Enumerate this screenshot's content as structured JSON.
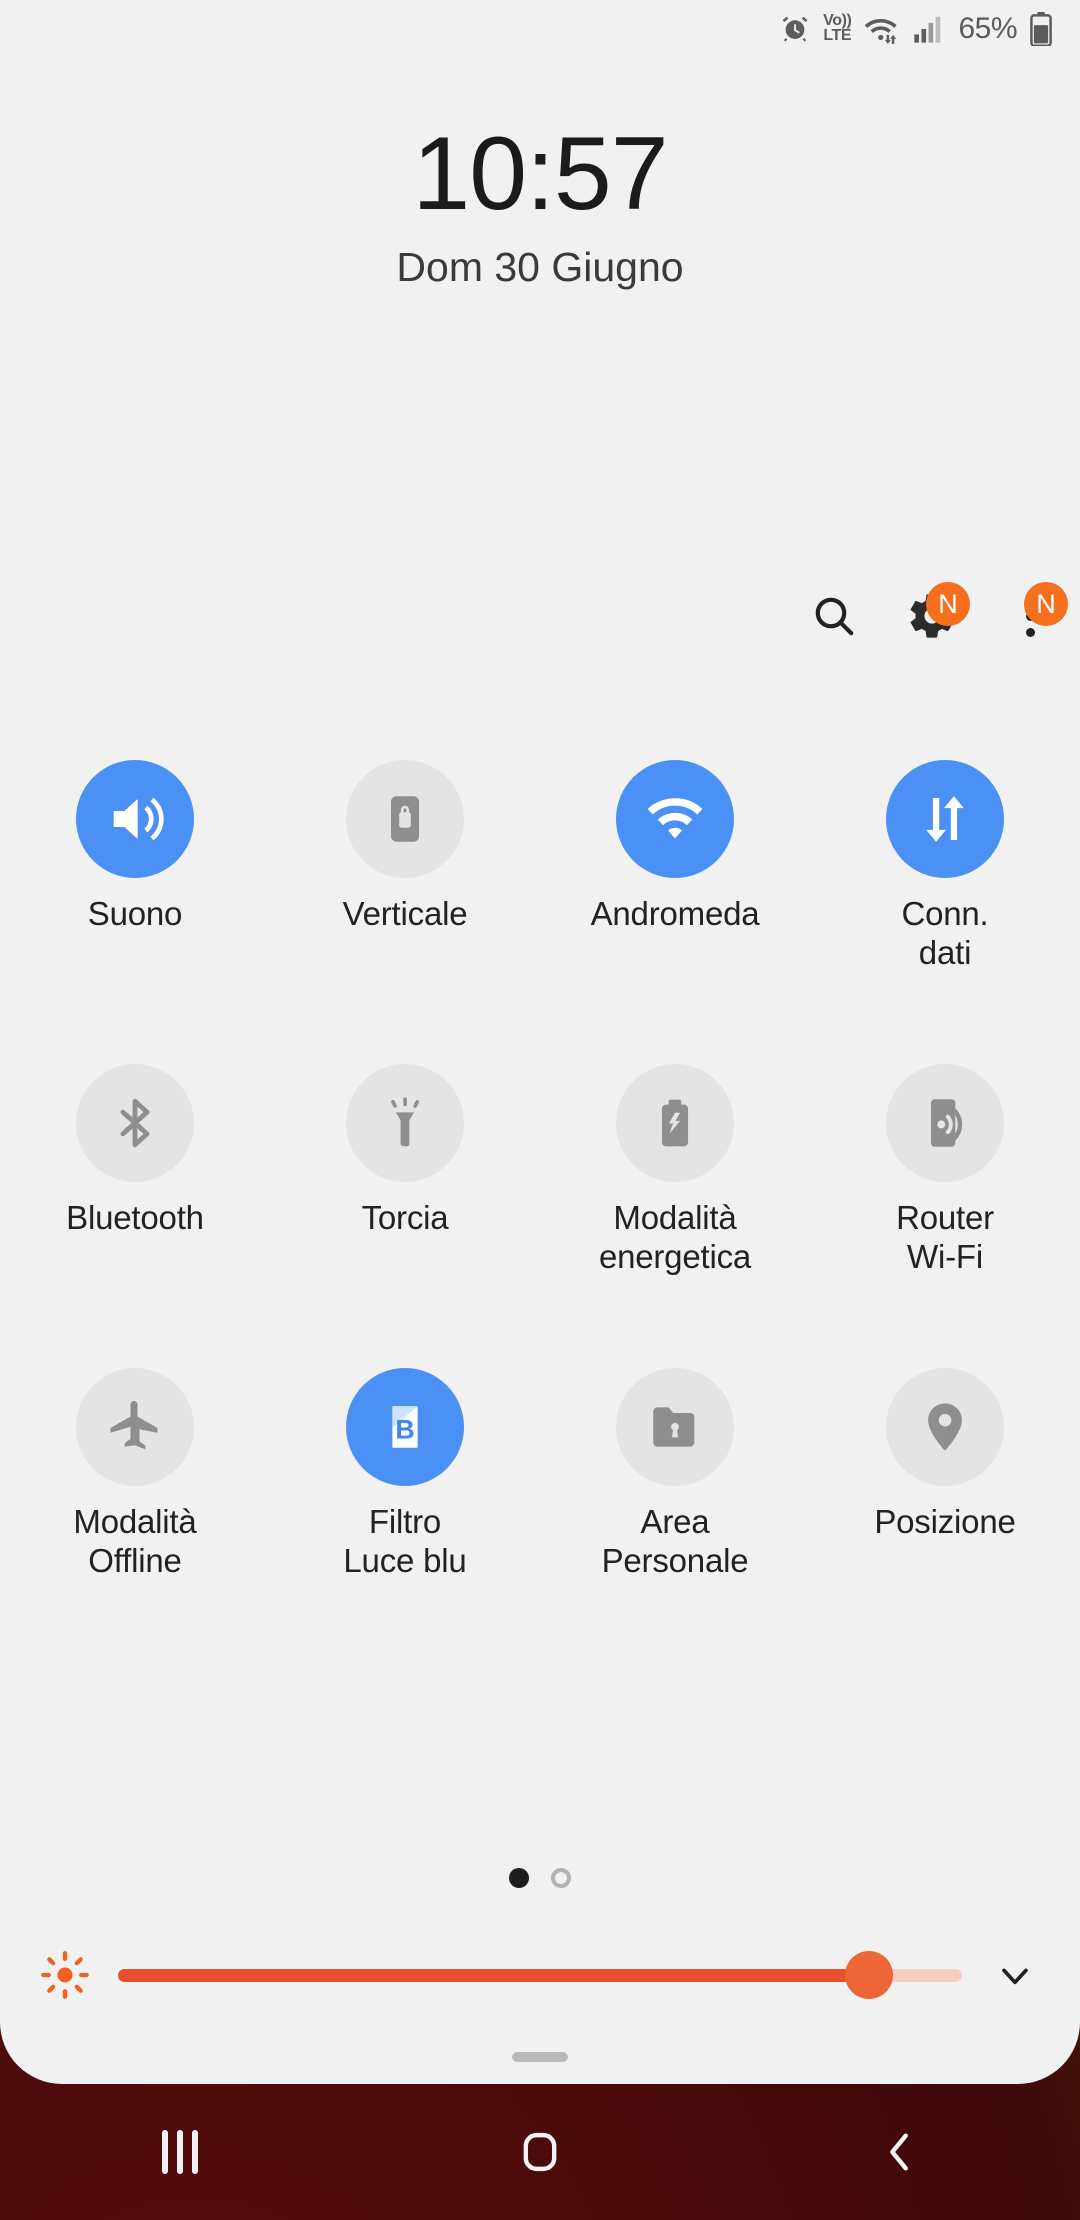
{
  "statusbar": {
    "alarm_icon": "alarm-clock-icon",
    "volte_top": "Vo))",
    "volte_bottom": "LTE",
    "wifi_icon": "wifi-data-transfer-icon",
    "signal_icon": "cellular-signal-icon",
    "battery_percent": "65%",
    "battery_icon": "battery-icon"
  },
  "clock": {
    "time": "10:57",
    "date": "Dom 30 Giugno"
  },
  "actions": {
    "search": {
      "name": "search-icon",
      "label": "Cerca"
    },
    "settings": {
      "name": "gear-icon",
      "label": "Impostazioni",
      "badge": "N"
    },
    "more": {
      "name": "more-options-icon",
      "label": "Altro",
      "badge": "N"
    }
  },
  "tiles": [
    {
      "label": "Suono",
      "icon": "sound-on-icon",
      "active": true
    },
    {
      "label": "Verticale",
      "icon": "rotation-lock-icon",
      "active": false
    },
    {
      "label": "Andromeda",
      "icon": "wifi-icon",
      "active": true
    },
    {
      "label": "Conn.\ndati",
      "icon": "mobile-data-icon",
      "active": true
    },
    {
      "label": "Bluetooth",
      "icon": "bluetooth-icon",
      "active": false
    },
    {
      "label": "Torcia",
      "icon": "flashlight-icon",
      "active": false
    },
    {
      "label": "Modalità\nenergetica",
      "icon": "power-saving-icon",
      "active": false
    },
    {
      "label": "Router\nWi-Fi",
      "icon": "mobile-hotspot-icon",
      "active": false
    },
    {
      "label": "Modalità\nOffline",
      "icon": "airplane-mode-icon",
      "active": false
    },
    {
      "label": "Filtro\nLuce blu",
      "icon": "blue-light-filter-icon",
      "active": true
    },
    {
      "label": "Area\nPersonale",
      "icon": "secure-folder-icon",
      "active": false
    },
    {
      "label": "Posizione",
      "icon": "location-pin-icon",
      "active": false
    }
  ],
  "pager": {
    "pages": 2,
    "current": 1
  },
  "brightness": {
    "icon": "brightness-sun-icon",
    "value": 89,
    "expand_icon": "chevron-down-icon"
  },
  "panel_handle": "drag-handle",
  "navbar": {
    "recents": "recent-apps-icon",
    "home": "home-icon",
    "back": "back-icon"
  },
  "colors": {
    "accent_blue": "#4a90f5",
    "badge_orange": "#f4701f",
    "slider_orange": "#e8502d",
    "panel_bg": "#f1f1f1",
    "tile_off": "#e4e4e4"
  }
}
